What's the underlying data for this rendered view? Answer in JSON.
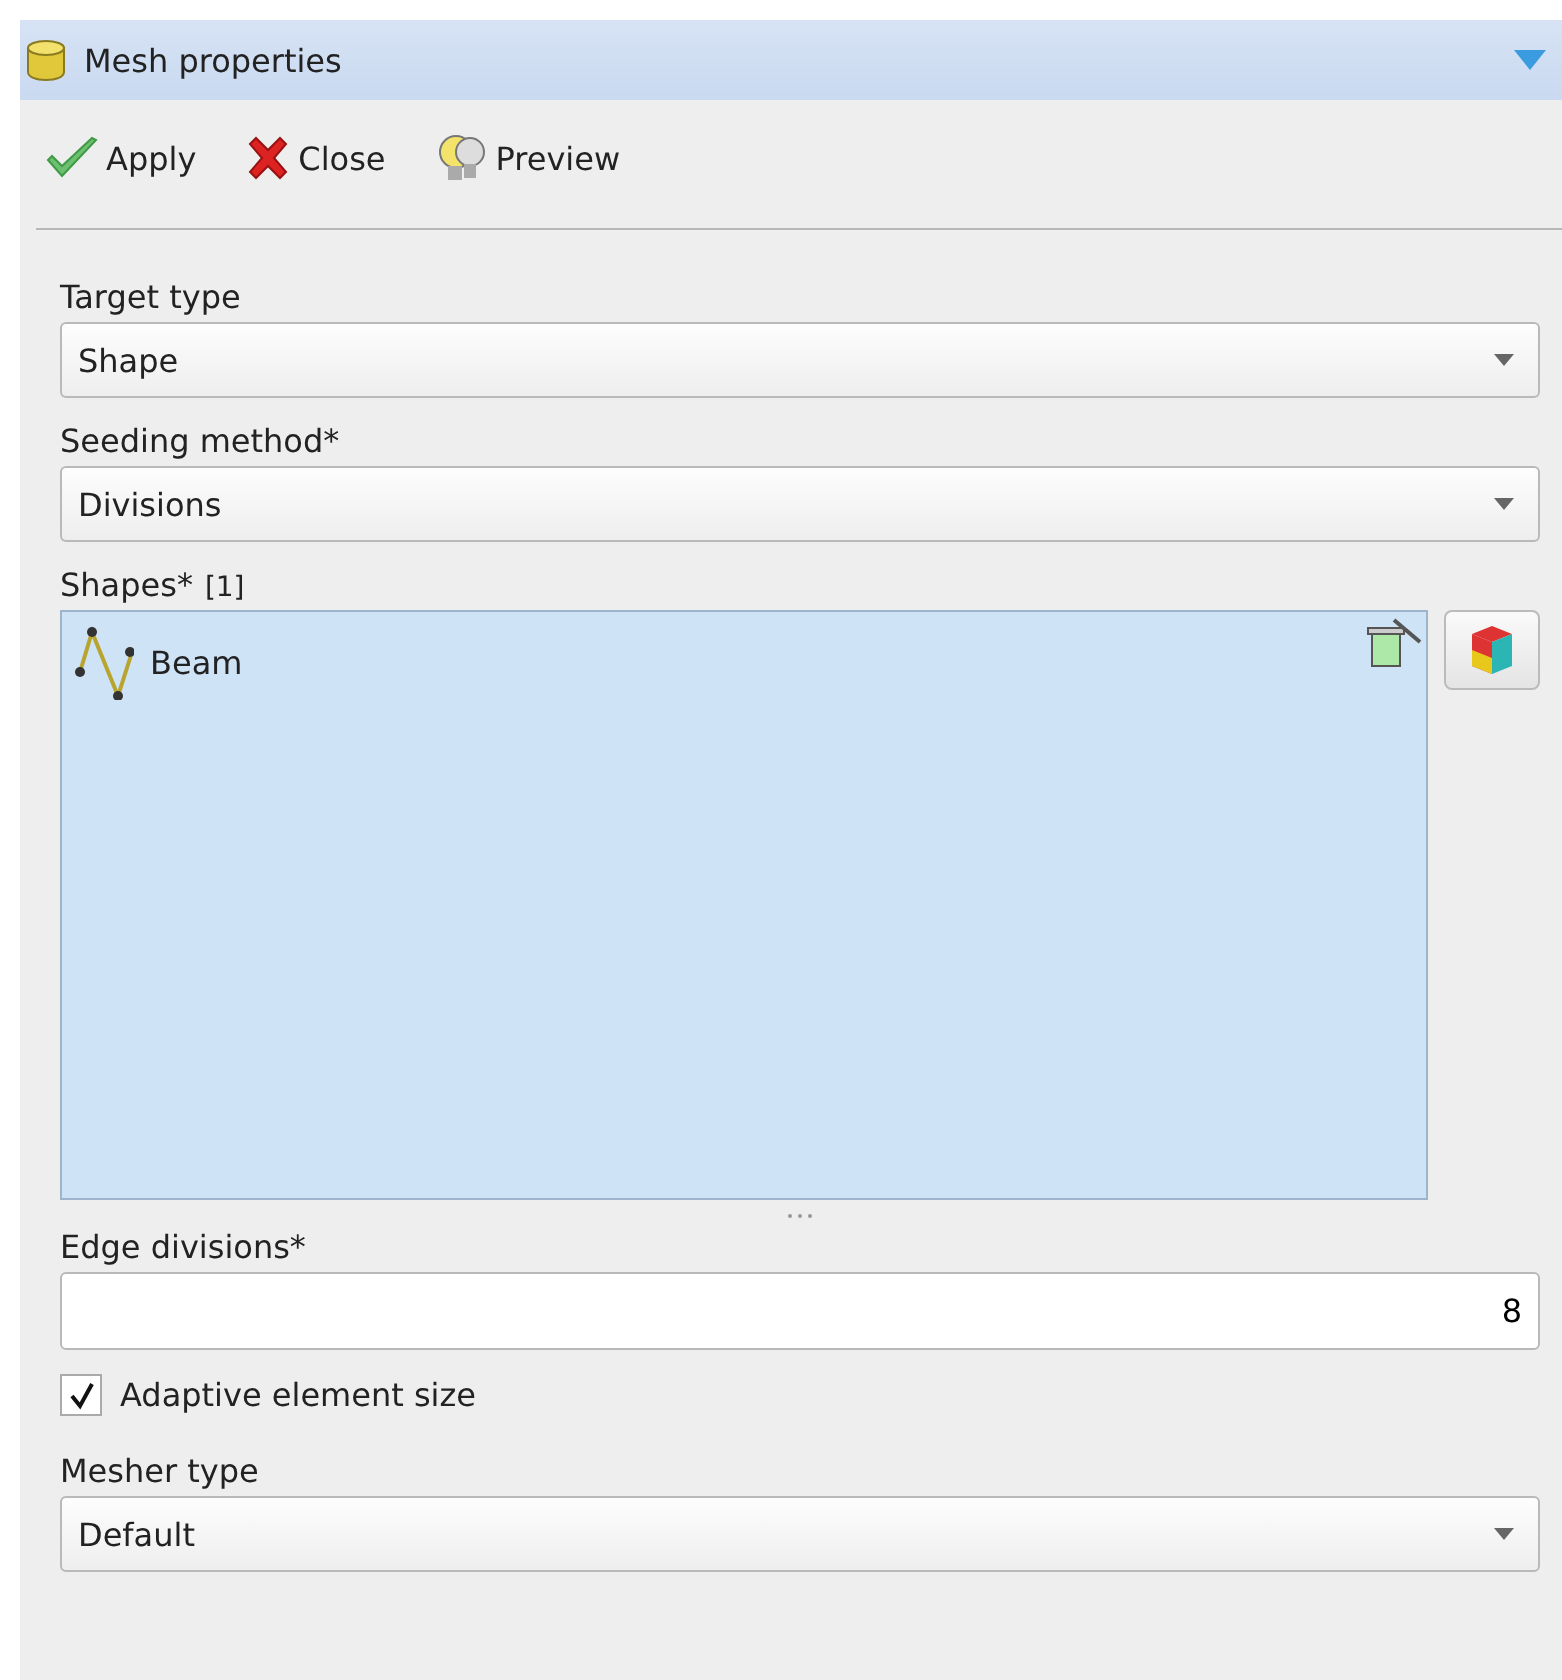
{
  "panel": {
    "title": "Mesh properties",
    "expanded": true
  },
  "toolbar": [
    {
      "kind": "apply",
      "label": "Apply"
    },
    {
      "kind": "close",
      "label": "Close"
    },
    {
      "kind": "preview",
      "label": "Preview"
    }
  ],
  "target_type": {
    "label": "Target type",
    "value": "Shape"
  },
  "seeding_method": {
    "label": "Seeding method*",
    "value": "Divisions"
  },
  "shapes": {
    "label": "Shapes*",
    "count": "[1]",
    "items": [
      {
        "name": "Beam",
        "selected": true
      }
    ]
  },
  "edge_divisions": {
    "label": "Edge divisions*",
    "value": "8"
  },
  "adaptive": {
    "label": "Adaptive element size",
    "checked": true
  },
  "mesher_type": {
    "label": "Mesher type",
    "value": "Default"
  }
}
